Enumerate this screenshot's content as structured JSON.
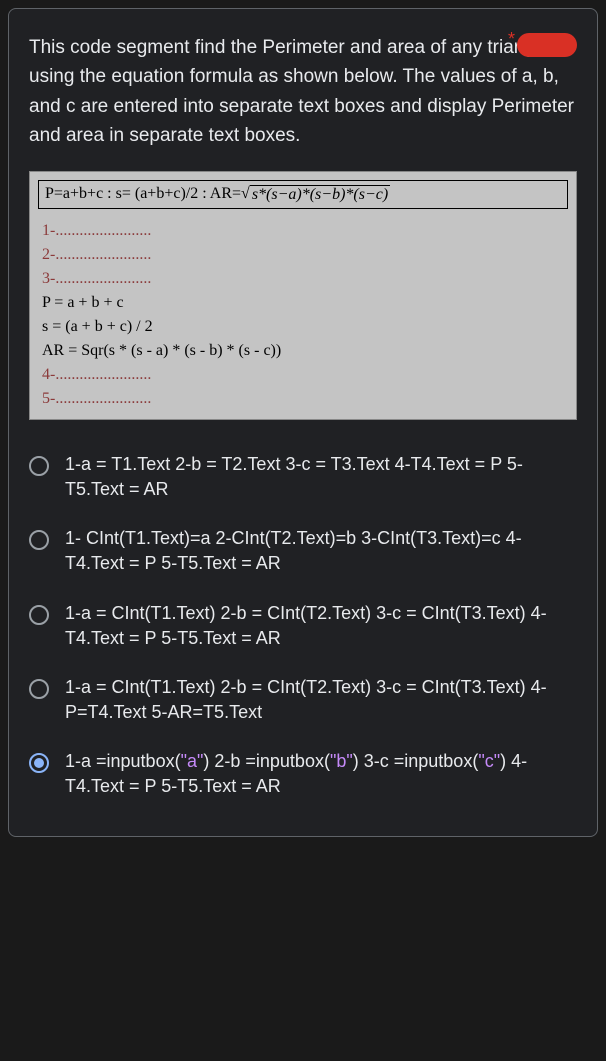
{
  "question": "This code segment find the Perimeter and area of any triangular using the equation formula as shown below. The values of a, b, and c are entered into separate text boxes and display Perimeter and area in separate text boxes.",
  "formula": {
    "prefix": "P=a+b+c :  s= (a+b+c)/2  :  AR=",
    "sqrt_glyph": "√",
    "sqrt_body": " s*(s−a)*(s−b)*(s−c)"
  },
  "code": {
    "line1": "1-........................",
    "line2": "2-........................",
    "line3": "3-........................",
    "line4": "P = a + b + c",
    "line5": "s = (a + b + c) / 2",
    "line6": "AR = Sqr(s * (s - a) * (s - b) * (s - c))",
    "line7": "4-........................",
    "line8": "5-........................"
  },
  "options": [
    {
      "text": "1-a = T1.Text 2-b = T2.Text 3-c = T3.Text 4-T4.Text = P 5-T5.Text = AR",
      "selected": false
    },
    {
      "text": "1- CInt(T1.Text)=a 2-CInt(T2.Text)=b 3-CInt(T3.Text)=c 4-T4.Text = P 5-T5.Text = AR",
      "selected": false
    },
    {
      "text": "1-a = CInt(T1.Text) 2-b = CInt(T2.Text) 3-c = CInt(T3.Text) 4-T4.Text = P 5-T5.Text = AR",
      "selected": false
    },
    {
      "text": "1-a = CInt(T1.Text) 2-b = CInt(T2.Text) 3-c = CInt(T3.Text) 4- P=T4.Text 5-AR=T5.Text",
      "selected": false
    },
    {
      "text_parts": [
        "1-a =inputbox(",
        "\"a\"",
        ") 2-b =inputbox(",
        "\"b\"",
        ") 3-c =inputbox(",
        "\"c\"",
        ") 4-T4.Text = P 5-T5.Text = AR"
      ],
      "selected": true
    }
  ]
}
